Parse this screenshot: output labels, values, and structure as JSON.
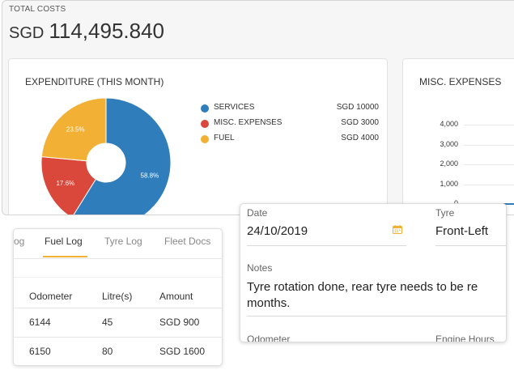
{
  "total_costs": {
    "label": "TOTAL COSTS",
    "currency": "SGD",
    "amount": "114,495.840"
  },
  "expenditure": {
    "title": "EXPENDITURE (THIS MONTH)",
    "legend": [
      {
        "name": "SERVICES",
        "value": "SGD 10000",
        "color": "#2f7dbb"
      },
      {
        "name": "MISC. EXPENSES",
        "value": "SGD 3000",
        "color": "#d9483b"
      },
      {
        "name": "FUEL",
        "value": "SGD 4000",
        "color": "#f2b134"
      }
    ]
  },
  "chart_data": [
    {
      "type": "pie",
      "title": "EXPENDITURE (THIS MONTH)",
      "categories": [
        "SERVICES",
        "MISC. EXPENSES",
        "FUEL"
      ],
      "values": [
        58.8,
        17.6,
        23.5
      ],
      "labels": [
        "58.8%",
        "17.6%",
        "23.5%"
      ],
      "colors": [
        "#2f7dbb",
        "#d9483b",
        "#f2b134"
      ]
    },
    {
      "type": "bar",
      "title": "MISC. EXPENSES",
      "yticks": [
        "4,000",
        "3,000",
        "2,000",
        "1,000",
        "0"
      ],
      "ylim": [
        0,
        4000
      ]
    }
  ],
  "misc": {
    "title": "MISC. EXPENSES"
  },
  "tabs": [
    {
      "label": "og"
    },
    {
      "label": "Fuel Log"
    },
    {
      "label": "Tyre Log"
    },
    {
      "label": "Fleet Docs"
    }
  ],
  "fuel_table": {
    "headers": [
      "Odometer",
      "Litre(s)",
      "Amount"
    ],
    "rows": [
      [
        "6144",
        "45",
        "SGD 900"
      ],
      [
        "6150",
        "80",
        "SGD 1600"
      ]
    ]
  },
  "detail": {
    "date_label": "Date",
    "date_value": "24/10/2019",
    "tyre_label": "Tyre",
    "tyre_value": "Front-Left",
    "notes_label": "Notes",
    "notes_line1": "Tyre rotation done, rear tyre needs to be re",
    "notes_line2": "months.",
    "odometer_label": "Odometer",
    "engine_label": "Engine Hours"
  }
}
